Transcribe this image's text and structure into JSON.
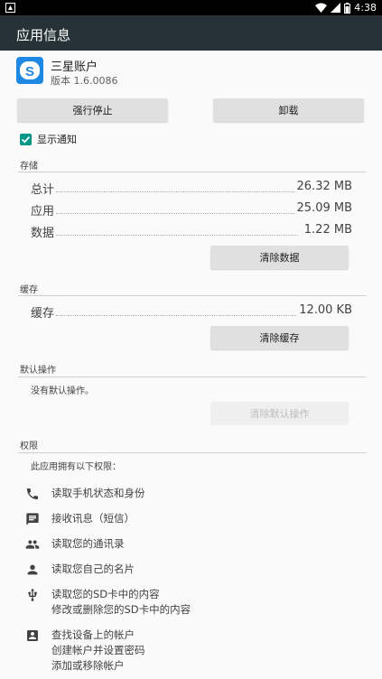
{
  "status_bar": {
    "time": "4:38"
  },
  "app_bar": {
    "title": "应用信息"
  },
  "app": {
    "name": "三星账户",
    "version": "版本 1.6.0086"
  },
  "buttons": {
    "force_stop": "强行停止",
    "uninstall": "卸载",
    "clear_data": "清除数据",
    "clear_cache": "清除缓存",
    "clear_defaults": "清除默认操作"
  },
  "notifications": {
    "label": "显示通知",
    "checked": true
  },
  "storage": {
    "title": "存储",
    "rows": [
      {
        "label": "总计",
        "value": "26.32 MB"
      },
      {
        "label": "应用",
        "value": "25.09 MB"
      },
      {
        "label": "数据",
        "value": "1.22 MB"
      }
    ]
  },
  "cache": {
    "title": "缓存",
    "rows": [
      {
        "label": "缓存",
        "value": "12.00 KB"
      }
    ]
  },
  "defaults": {
    "title": "默认操作",
    "text": "没有默认操作。"
  },
  "permissions": {
    "title": "权限",
    "intro": "此应用拥有以下权限：",
    "items": [
      {
        "icon": "phone-icon",
        "lines": [
          "读取手机状态和身份"
        ]
      },
      {
        "icon": "message-icon",
        "lines": [
          "接收讯息（短信）"
        ]
      },
      {
        "icon": "contacts-icon",
        "lines": [
          "读取您的通讯录"
        ]
      },
      {
        "icon": "person-icon",
        "lines": [
          "读取您自己的名片"
        ]
      },
      {
        "icon": "usb-icon",
        "lines": [
          "读取您的SD卡中的内容",
          "修改或删除您的SD卡中的内容"
        ]
      },
      {
        "icon": "account-box-icon",
        "lines": [
          "查找设备上的帐户",
          "创建帐户并设置密码",
          "添加或移除帐户"
        ]
      }
    ]
  },
  "colors": {
    "app_bar": "#263238",
    "accent": "#009688",
    "app_icon": "#1e88e5"
  }
}
